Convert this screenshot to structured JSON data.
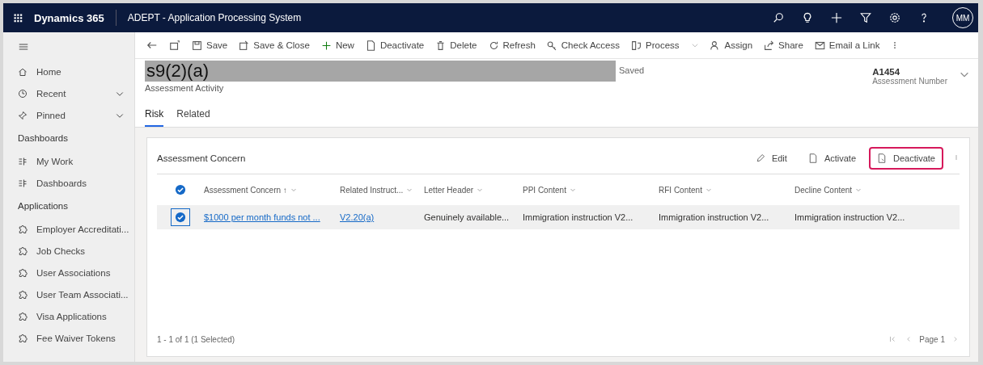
{
  "top_bar": {
    "brand": "Dynamics 365",
    "app_title": "ADEPT - Application Processing System",
    "avatar": "MM"
  },
  "sidebar": {
    "items": [
      {
        "label": "Home",
        "kind": "link"
      },
      {
        "label": "Recent",
        "kind": "flyout"
      },
      {
        "label": "Pinned",
        "kind": "flyout"
      }
    ],
    "sections": [
      {
        "title": "Dashboards",
        "items": [
          "My Work",
          "Dashboards"
        ]
      },
      {
        "title": "Applications",
        "items": [
          "Employer Accreditati...",
          "Job Checks",
          "User Associations",
          "User Team Associati...",
          "Visa Applications",
          "Fee Waiver Tokens"
        ]
      }
    ]
  },
  "command_bar": [
    "Save",
    "Save & Close",
    "New",
    "Deactivate",
    "Delete",
    "Refresh",
    "Check Access",
    "Process",
    "Assign",
    "Share",
    "Email a Link"
  ],
  "record": {
    "redaction": "s9(2)(a)",
    "save_status": "Saved",
    "entity": "Assessment Activity",
    "number": "A1454",
    "number_label": "Assessment Number"
  },
  "tabs": [
    {
      "label": "Risk",
      "selected": true
    },
    {
      "label": "Related",
      "selected": false
    }
  ],
  "subgrid": {
    "title": "Assessment Concern",
    "actions": [
      {
        "label": "Edit",
        "highlighted": false
      },
      {
        "label": "Activate",
        "highlighted": false
      },
      {
        "label": "Deactivate",
        "highlighted": true
      }
    ],
    "select_all": true,
    "columns": [
      {
        "label": "Assessment Concern",
        "sort": "↑"
      },
      {
        "label": "Related Instruct..."
      },
      {
        "label": "Letter Header"
      },
      {
        "label": "PPI Content"
      },
      {
        "label": "RFI Content"
      },
      {
        "label": "Decline Content"
      }
    ],
    "rows": [
      {
        "selected": true,
        "cells": [
          "$1000 per month funds not ...",
          "V2.20(a)",
          "Genuinely available...",
          "Immigration instruction V2...",
          "Immigration instruction V2...",
          "Immigration instruction V2..."
        ]
      }
    ],
    "footer": "1 - 1 of 1 (1 Selected)",
    "page": "Page 1"
  }
}
